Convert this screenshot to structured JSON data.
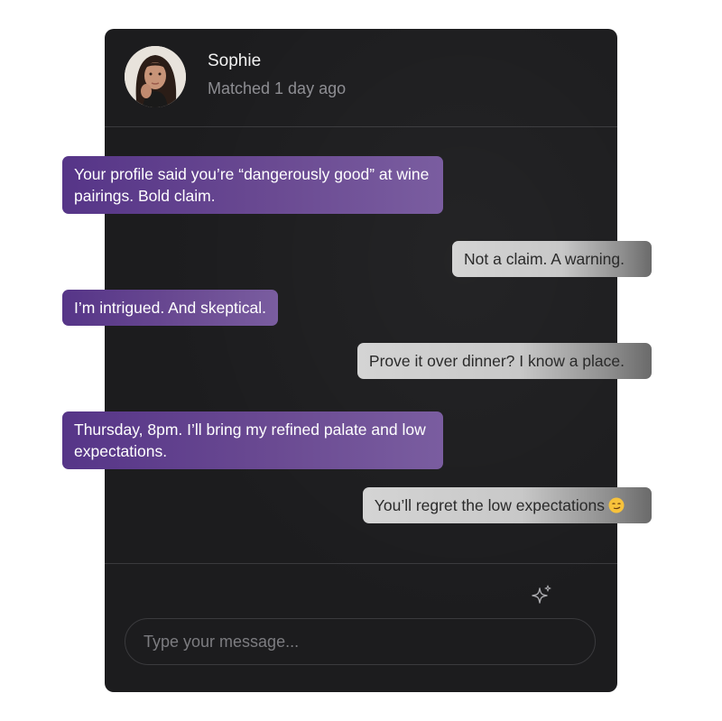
{
  "contact": {
    "name": "Sophie",
    "status": "Matched 1 day ago"
  },
  "messages": [
    {
      "direction": "sent",
      "text": "Your profile said you’re “dangerously good” at wine pairings. Bold claim."
    },
    {
      "direction": "received",
      "text": "Not a claim. A warning."
    },
    {
      "direction": "sent",
      "text": "I’m intrigued. And skeptical."
    },
    {
      "direction": "received",
      "text": "Prove it over dinner? I know a place."
    },
    {
      "direction": "sent",
      "text": "Thursday, 8pm. I’ll bring my refined palate and low expectations."
    },
    {
      "direction": "received",
      "text": "You’ll regret the low expectations",
      "emoji": "smirk-emoji"
    }
  ],
  "composer": {
    "placeholder": "Type your message...",
    "value": "",
    "ai_icon": "sparkle-icon"
  },
  "colors": {
    "card_background": "#1c1c1e",
    "sent_bubble": "#563588",
    "received_bubble": "#d4d4d4",
    "divider": "#3a3a3d"
  }
}
